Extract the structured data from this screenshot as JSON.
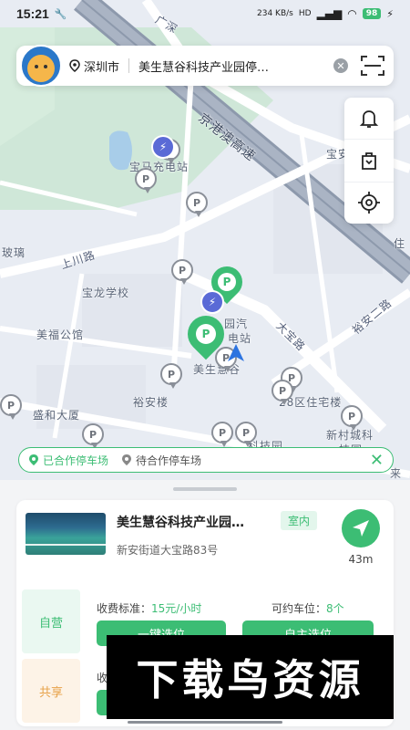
{
  "status_bar": {
    "time": "15:21",
    "net_speed": "234 KB/s",
    "signal": "HD",
    "battery": "98"
  },
  "search": {
    "city": "深圳市",
    "query": "美生慧谷科技产业园停…"
  },
  "map": {
    "labels": {
      "road_guangshen": "广深",
      "road_jinggang": "京港澳高速",
      "baoma": "宝马充电站",
      "baoan_ye": "宝安耶",
      "zhu": "住",
      "shangchuan": "上川路",
      "bolidong": "玻璃",
      "baolong": "宝龙学校",
      "meifu": "美福公馆",
      "dabao": "大宝路",
      "yuan_qi": "园汽",
      "dian_zhan": "电站",
      "meisheng": "美生慧谷",
      "yuan_an": "裕安二路",
      "yuan_lou": "裕安楼",
      "shengheda": "盛和大厦",
      "zhuzhai": "28区住宅楼",
      "xincun": "新村城科",
      "jiyuan": "技园",
      "kejiyuan": "科技园",
      "yuan_mid": "园",
      "lai": "来"
    }
  },
  "legend": {
    "cooperated": "已合作停车场",
    "pending": "待合作停车场"
  },
  "lot": {
    "name": "美生慧谷科技产业园…",
    "tag": "室内",
    "address": "新安街道大宝路83号",
    "distance": "43m"
  },
  "rows": {
    "self": {
      "type": "自营",
      "fee_label": "收费标准：",
      "fee_value": "15元/小时",
      "spaces_label": "可约车位：",
      "spaces_value": "8个",
      "btn_one": "一键选位",
      "btn_two": "自主选位"
    },
    "share": {
      "type": "共享",
      "fee_label": "收"
    }
  },
  "watermark": "下载鸟资源",
  "colors": {
    "accent": "#3cbd74",
    "share": "#e7a148"
  }
}
